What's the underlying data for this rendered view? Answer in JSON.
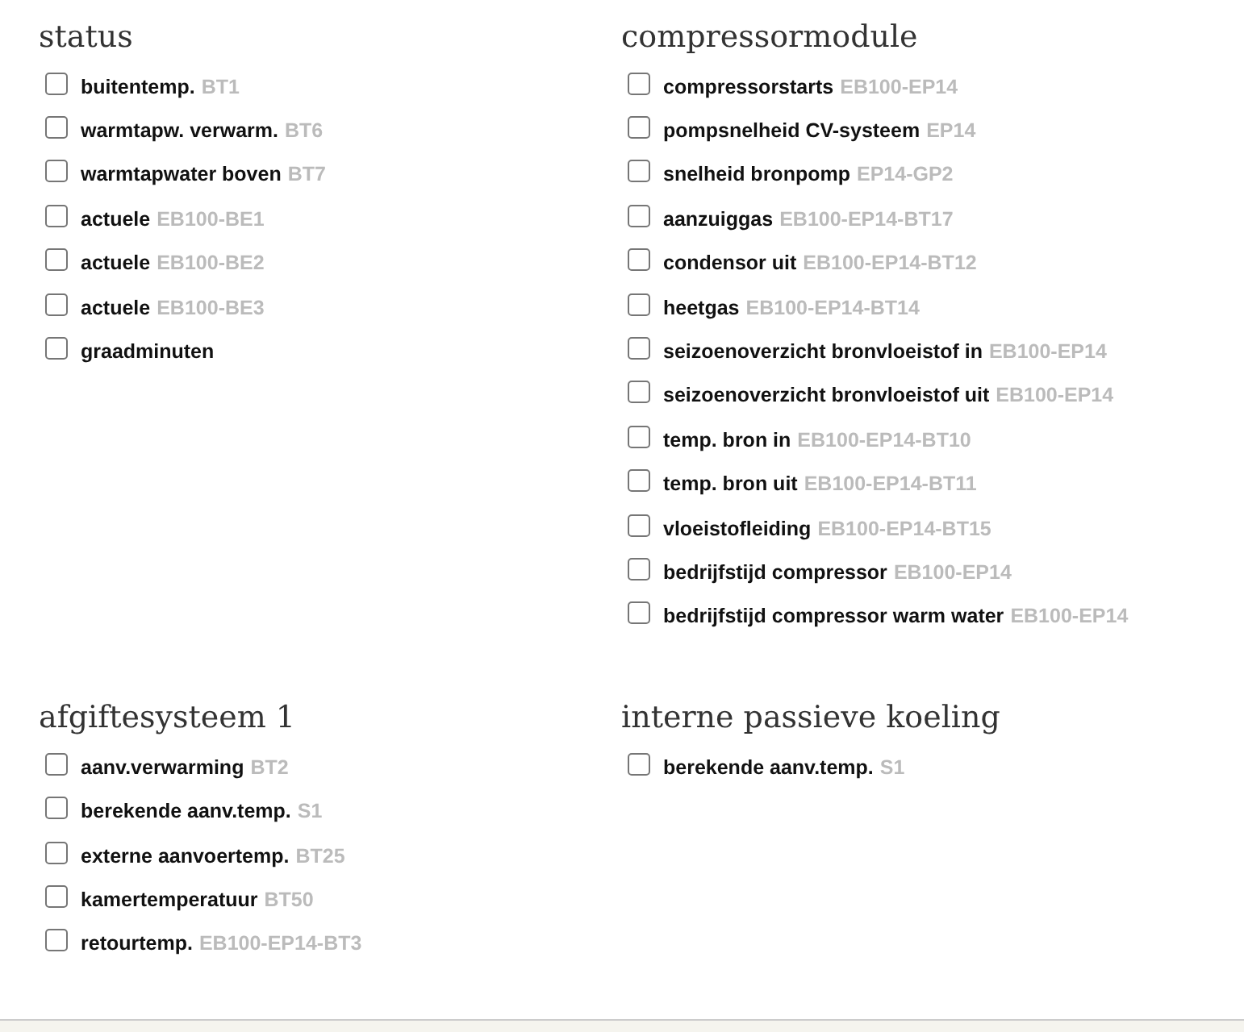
{
  "sections": [
    {
      "title": "status",
      "items": [
        {
          "label": "buitentemp.",
          "code": "BT1",
          "checked": false
        },
        {
          "label": "warmtapw. verwarm.",
          "code": "BT6",
          "checked": false
        },
        {
          "label": "warmtapwater boven",
          "code": "BT7",
          "checked": false
        },
        {
          "label": "actuele",
          "code": "EB100-BE1",
          "checked": false
        },
        {
          "label": "actuele",
          "code": "EB100-BE2",
          "checked": false
        },
        {
          "label": "actuele",
          "code": "EB100-BE3",
          "checked": false
        },
        {
          "label": "graadminuten",
          "checked": false
        }
      ]
    },
    {
      "title": "compressormodule",
      "items": [
        {
          "label": "compressorstarts",
          "code": "EB100-EP14",
          "checked": false
        },
        {
          "label": "pompsnelheid CV-systeem",
          "code": "EP14",
          "checked": false
        },
        {
          "label": "snelheid bronpomp",
          "code": "EP14-GP2",
          "checked": false
        },
        {
          "label": "aanzuiggas",
          "code": "EB100-EP14-BT17",
          "checked": false
        },
        {
          "label": "condensor uit",
          "code": "EB100-EP14-BT12",
          "checked": false
        },
        {
          "label": "heetgas",
          "code": "EB100-EP14-BT14",
          "checked": false
        },
        {
          "label": "seizoenoverzicht bronvloeistof in",
          "code": "EB100-EP14",
          "checked": false
        },
        {
          "label": "seizoenoverzicht bronvloeistof uit",
          "code": "EB100-EP14",
          "checked": false
        },
        {
          "label": "temp. bron in",
          "code": "EB100-EP14-BT10",
          "checked": false
        },
        {
          "label": "temp. bron uit",
          "code": "EB100-EP14-BT11",
          "checked": false
        },
        {
          "label": "vloeistofleiding",
          "code": "EB100-EP14-BT15",
          "checked": false
        },
        {
          "label": "bedrijfstijd compressor",
          "code": "EB100-EP14",
          "checked": false
        },
        {
          "label": "bedrijfstijd compressor warm water",
          "code": "EB100-EP14",
          "checked": false
        }
      ]
    },
    {
      "title": "afgiftesysteem 1",
      "items": [
        {
          "label": "aanv.verwarming",
          "code": "BT2",
          "checked": false
        },
        {
          "label": "berekende aanv.temp.",
          "code": "S1",
          "checked": false
        },
        {
          "label": "externe aanvoertemp.",
          "code": "BT25",
          "checked": false
        },
        {
          "label": "kamertemperatuur",
          "code": "BT50",
          "checked": false
        },
        {
          "label": "retourtemp.",
          "code": "EB100-EP14-BT3",
          "checked": false
        }
      ]
    },
    {
      "title": "interne passieve koeling",
      "items": [
        {
          "label": "berekende aanv.temp.",
          "code": "S1",
          "checked": false
        }
      ]
    }
  ]
}
